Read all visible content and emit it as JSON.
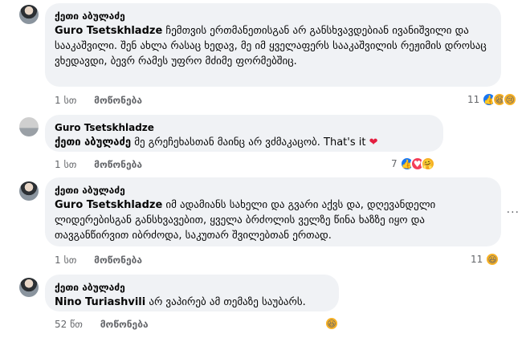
{
  "comments": [
    {
      "author": "ქეთი აბულაძე",
      "mention": "Guro Tsetskhladze",
      "text": " ჩემთვის ერთმანეთისგან არ განსხვავდებიან ივანიშვილი და სააკაშვილი. შენ ახლა რასაც ხედავ, მე იმ ყველაფერს სააკაშვილის რეჟიმის დროსაც ვხედავდი, ბევრ რამეს უფრო მძიმე ფორმებშიც.",
      "time": "1 სთ",
      "like_label": "მოწონება",
      "reaction_count": "11"
    },
    {
      "author": "Guro Tsetskhladze",
      "mention": "ქეთი აბულაძე",
      "text": " მე გრეჩეხასთან მაინც არ ვძმაკაცობ. That's it",
      "emoji": "❤",
      "time": "1 სთ",
      "like_label": "მოწონება",
      "reaction_count": "7"
    },
    {
      "author": "ქეთი აბულაძე",
      "mention": "Guro Tsetskhladze",
      "text": " იმ ადამიანს სახელი და გვარი აქვს და, დღევანდელი ლიდერებისგან განსხვავებით, ყველა ბრძოლის ველზე წინა ხაზზე იყო და თავგანწირვით იბრძოდა, საკუთარ შვილებთან ერთად.",
      "time": "1 სთ",
      "like_label": "მოწონება",
      "reaction_count": "11"
    },
    {
      "author": "ქეთი აბულაძე",
      "mention": "Nino Turiashvili",
      "text": " არ ვაპირებ ამ თემაზე საუბარს.",
      "time": "52 წთ",
      "like_label": "მოწონება",
      "reaction_count": ""
    }
  ],
  "more_icon": "···",
  "reaction_icons": [
    "like",
    "haha",
    "sad",
    "love",
    "care"
  ]
}
